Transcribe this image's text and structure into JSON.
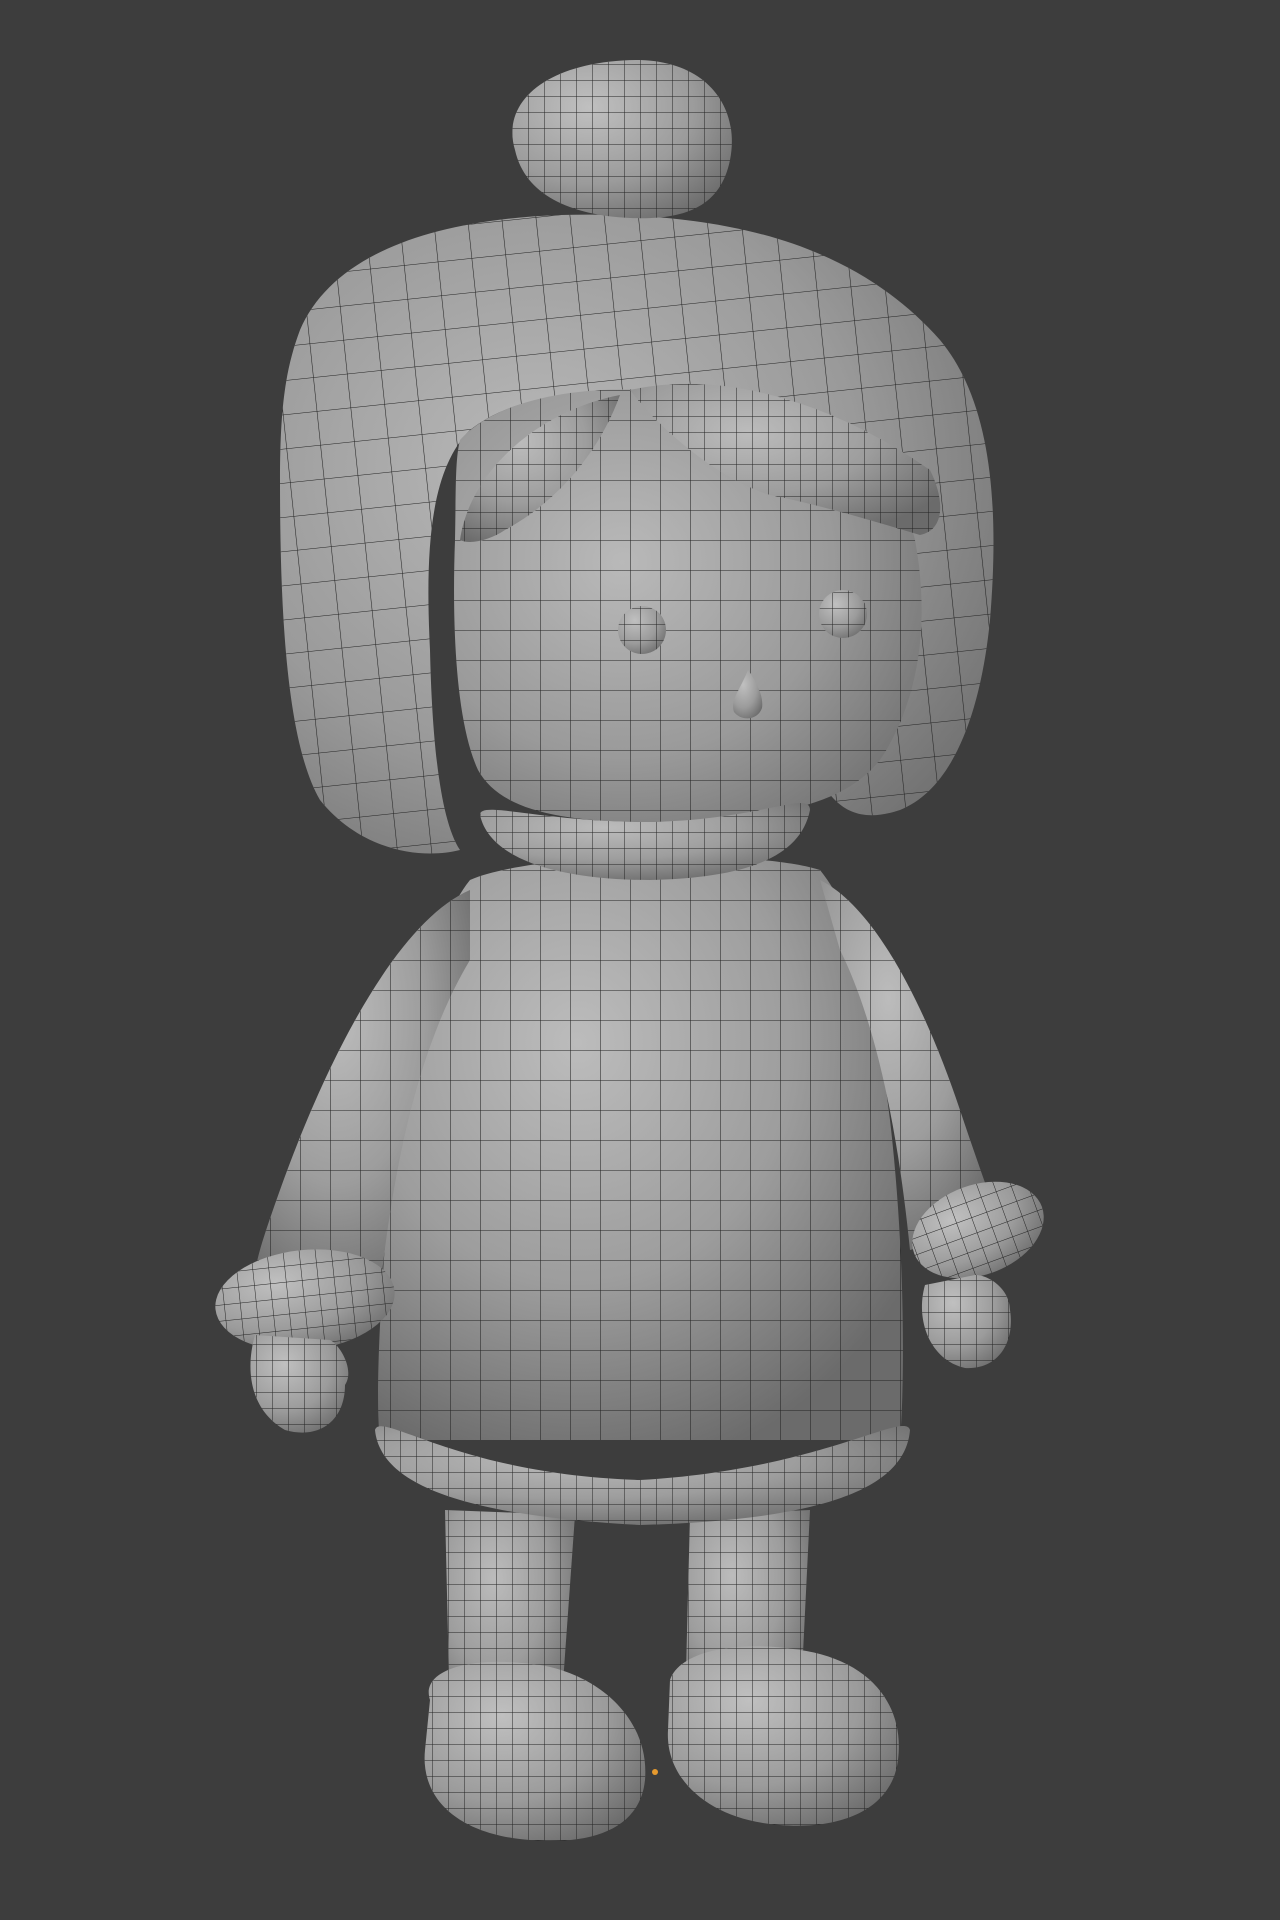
{
  "viewport": {
    "background": "#3d3d3d",
    "shading": "solid",
    "overlay": "wireframe",
    "wire_color": "#1e1e1e"
  },
  "model": {
    "surface_color": "#9c9c9c",
    "highlight_color": "#b6b6b6",
    "shadow_color": "#6e6e6e",
    "parts": [
      "pompom",
      "hood",
      "hair-bangs",
      "face",
      "eyes",
      "nose",
      "collar",
      "coat",
      "sleeves",
      "cuffs",
      "mittens",
      "coat-hem",
      "legs",
      "boots"
    ]
  },
  "origin_marker": {
    "color": "#e69a2e",
    "icon": "object-origin-dot"
  }
}
